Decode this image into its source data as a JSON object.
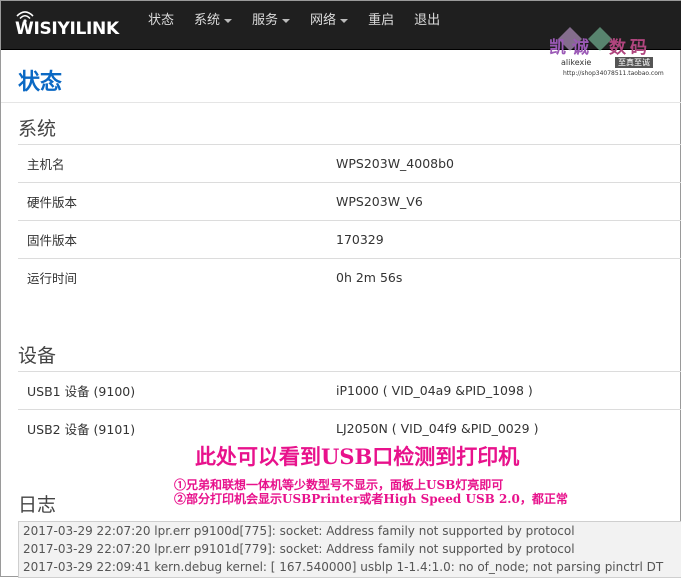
{
  "app": {
    "brand": "WISIYILINK",
    "nav": [
      {
        "label": "状态",
        "has_caret": false
      },
      {
        "label": "系统",
        "has_caret": true
      },
      {
        "label": "服务",
        "has_caret": true
      },
      {
        "label": "网络",
        "has_caret": true
      },
      {
        "label": "重启",
        "has_caret": false
      },
      {
        "label": "退出",
        "has_caret": false
      }
    ]
  },
  "watermark": {
    "brand_cn_1": "凯诚",
    "brand_cn_2": "数码",
    "handle": "alikexie",
    "tag": "至真至诚",
    "url": "http://shop34078511.taobao.com"
  },
  "page": {
    "title": "状态",
    "system": {
      "heading": "系统",
      "rows": [
        {
          "label": "主机名",
          "value": "WPS203W_4008b0"
        },
        {
          "label": "硬件版本",
          "value": "WPS203W_V6"
        },
        {
          "label": "固件版本",
          "value": "170329"
        },
        {
          "label": "运行时间",
          "value": "0h 2m 56s"
        }
      ]
    },
    "devices": {
      "heading": "设备",
      "rows": [
        {
          "label": "USB1 设备 (9100)",
          "value": "iP1000 ( VID_04a9 &PID_1098 )"
        },
        {
          "label": "USB2 设备 (9101)",
          "value": "LJ2050N ( VID_04f9 &PID_0029 )"
        }
      ]
    },
    "annotation": {
      "headline": "此处可以看到USB口检测到打印机",
      "line1": "①兄弟和联想一体机等少数型号不显示，面板上USB灯亮即可",
      "line2": "②部分打印机会显示USBPrinter或者High Speed USB 2.0，都正常"
    },
    "log": {
      "heading": "日志",
      "lines": [
        "2017-03-29 22:07:20 lpr.err p9100d[775]: socket: Address family not supported by protocol",
        "2017-03-29 22:07:20 lpr.err p9101d[779]: socket: Address family not supported by protocol",
        "2017-03-29 22:09:41 kern.debug kernel: [ 167.540000] usblp 1-1.4:1.0: no of_node; not parsing pinctrl DT"
      ]
    }
  },
  "colors": {
    "nav_bg": "#1f1f1f",
    "title_blue": "#0b69c4",
    "link_blue": "#2a6fb8",
    "annotation_pink": "#e8128c"
  }
}
